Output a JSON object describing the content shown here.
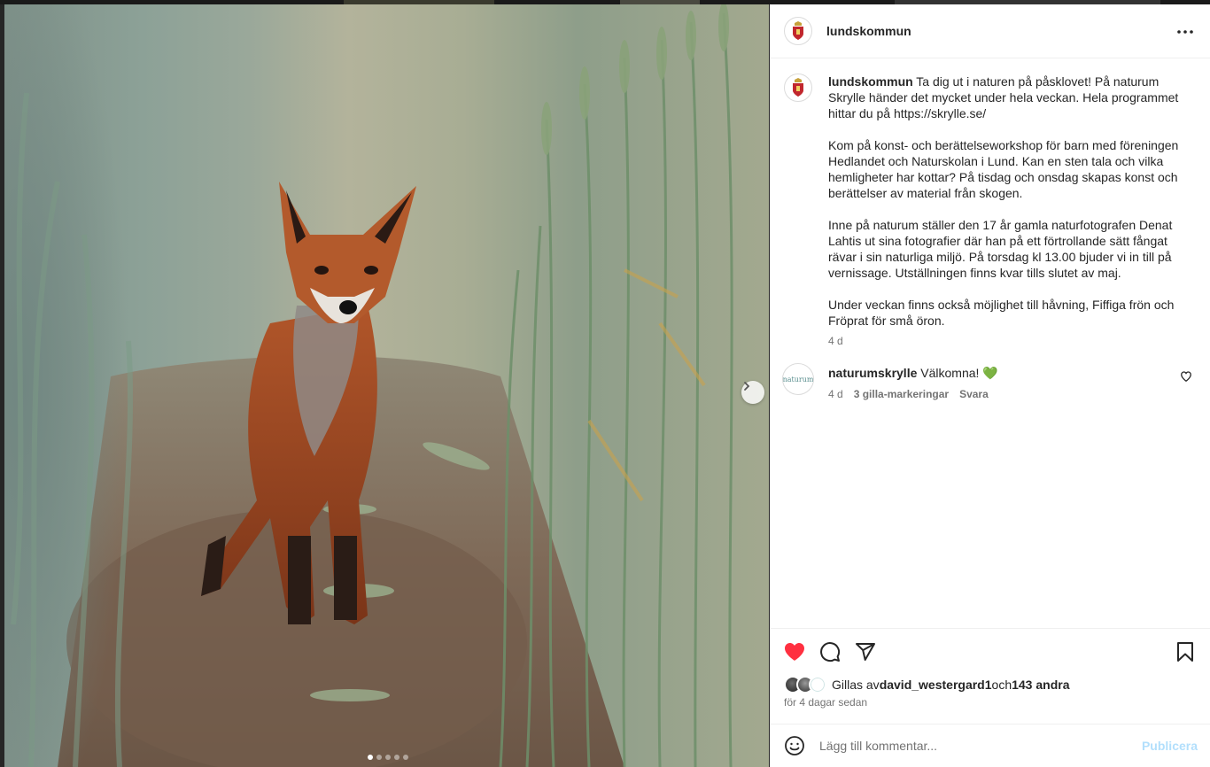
{
  "post": {
    "username": "lundskommun",
    "more_icon": "more-horizontal-icon",
    "image": {
      "alt_subject": "fox-in-wheat-field",
      "carousel_dots": 5,
      "active_dot": 0,
      "next_icon": "chevron-right-icon"
    }
  },
  "caption": {
    "username": "lundskommun",
    "text": " Ta dig ut i naturen på påsklovet! På naturum Skrylle händer det mycket under hela veckan. Hela programmet hittar du på https://skrylle.se/\n\nKom på konst- och berättelseworkshop för barn med föreningen Hedlandet och Naturskolan i Lund. Kan en sten tala och vilka hemligheter har kottar? På tisdag och onsdag skapas konst och berättelser av material från skogen.\n\nInne på naturum ställer den 17 år gamla naturfotografen Denat Lahtis ut sina fotografier där han på ett förtrollande sätt fångat rävar i sin naturliga miljö. På torsdag kl 13.00 bjuder vi in till på vernissage. Utställningen finns kvar tills slutet av maj.\n\nUnder veckan finns också möjlighet till håvning, Fiffiga frön och Fröprat för små öron.",
    "time": "4 d"
  },
  "comments": [
    {
      "username": "naturumskrylle",
      "text": " Välkomna! 💚",
      "time": "4 d",
      "likes": "3 gilla-markeringar",
      "reply": "Svara",
      "avatar_text": "naturum"
    }
  ],
  "actions": {
    "like_icon": "heart-filled-icon",
    "comment_icon": "comment-icon",
    "share_icon": "share-icon",
    "save_icon": "bookmark-icon",
    "like_color": "#ff3040"
  },
  "likes": {
    "prefix": "Gillas av ",
    "first_user": "david_westergard1",
    "joiner": " och ",
    "others": "143 andra"
  },
  "date": "för 4 dagar sedan",
  "add_comment": {
    "emoji_icon": "emoji-smile-icon",
    "placeholder": "Lägg till kommentar...",
    "publish_label": "Publicera",
    "publish_color": "#b2dffc"
  }
}
